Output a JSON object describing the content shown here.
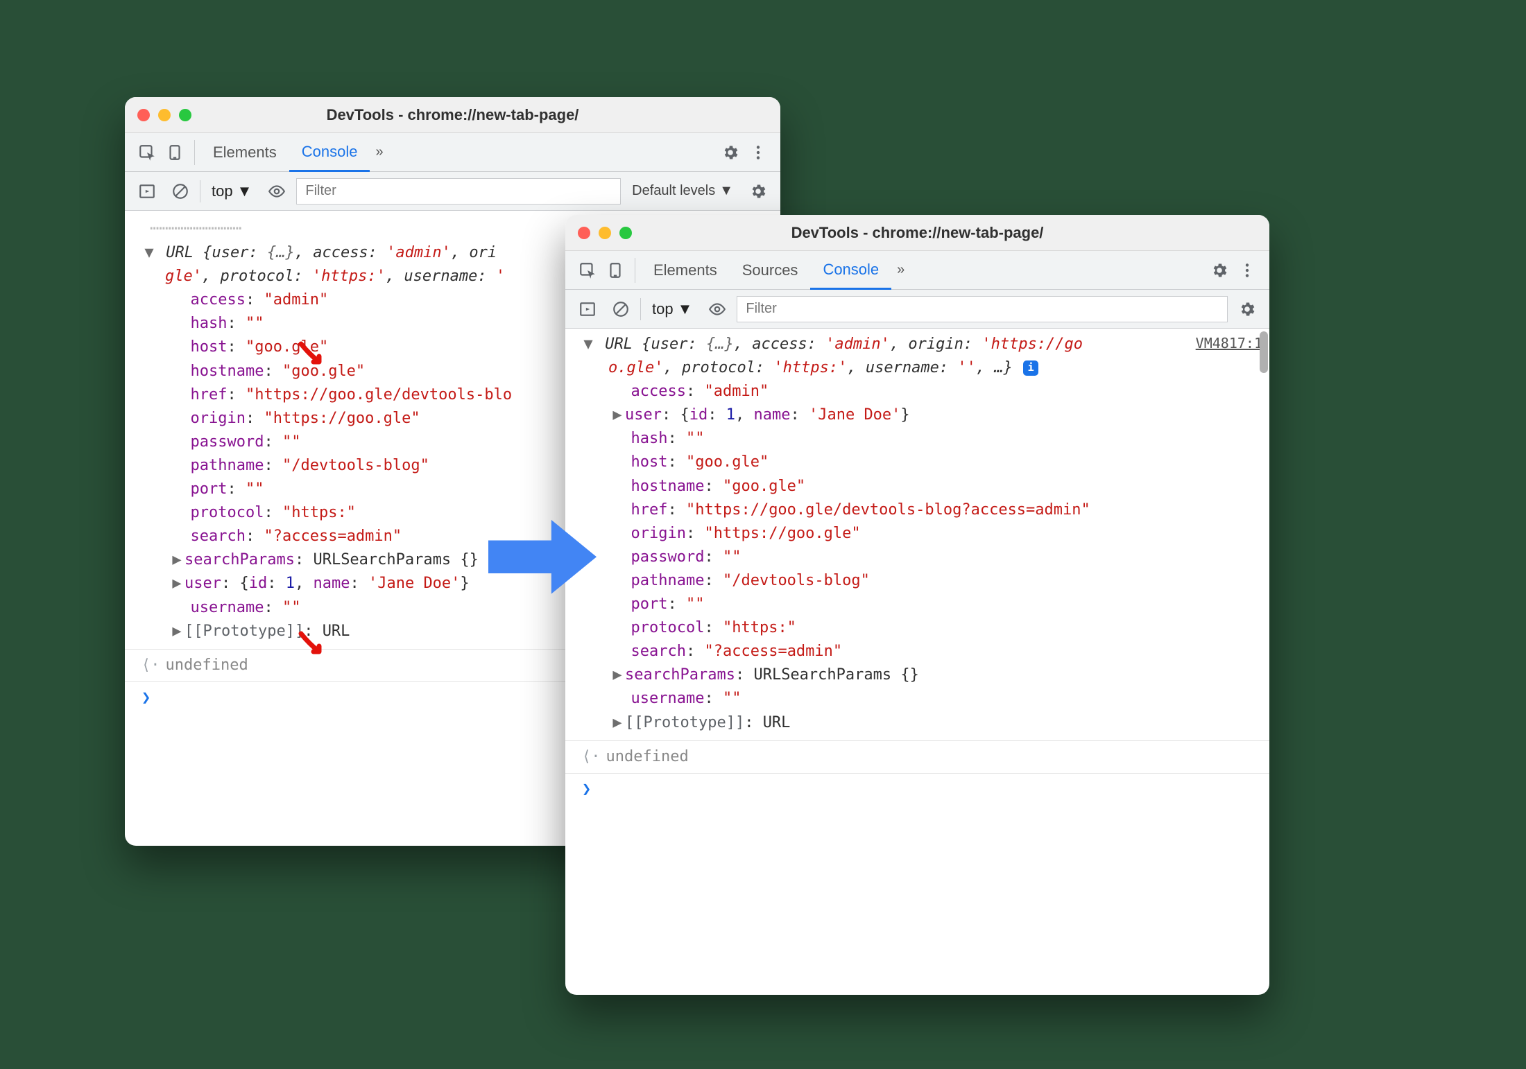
{
  "leftWindow": {
    "title": "DevTools - chrome://new-tab-page/",
    "tabs": {
      "elements": "Elements",
      "console": "Console",
      "active": "console"
    },
    "filterPlaceholder": "Filter",
    "context": "top",
    "levelsLabel": "Default levels",
    "fadedPrev": "console.log(temp);",
    "summary": {
      "class": "URL",
      "line1_parts": [
        "{user: ",
        "{…}",
        ", access: ",
        "'admin'",
        ", orig"
      ],
      "line2_parts": [
        "gle'",
        ", protocol: ",
        "'https:'",
        ", username: ",
        "'"
      ]
    },
    "props": [
      {
        "k": "access",
        "v": "\"admin\"",
        "t": "str"
      },
      {
        "k": "hash",
        "v": "\"\"",
        "t": "str"
      },
      {
        "k": "host",
        "v": "\"goo.gle\"",
        "t": "str"
      },
      {
        "k": "hostname",
        "v": "\"goo.gle\"",
        "t": "str"
      },
      {
        "k": "href",
        "v": "\"https://goo.gle/devtools-blo",
        "t": "str"
      },
      {
        "k": "origin",
        "v": "\"https://goo.gle\"",
        "t": "str"
      },
      {
        "k": "password",
        "v": "\"\"",
        "t": "str"
      },
      {
        "k": "pathname",
        "v": "\"/devtools-blog\"",
        "t": "str"
      },
      {
        "k": "port",
        "v": "\"\"",
        "t": "str"
      },
      {
        "k": "protocol",
        "v": "\"https:\"",
        "t": "str"
      },
      {
        "k": "search",
        "v": "\"?access=admin\"",
        "t": "str"
      }
    ],
    "searchParamsLine": {
      "k": "searchParams",
      "cls": "URLSearchParams",
      "suffix": "{}"
    },
    "userLine": {
      "k": "user",
      "inner": [
        [
          "id",
          ": "
        ],
        [
          "1",
          ""
        ],
        [
          ", ",
          ""
        ],
        [
          "name",
          ": "
        ],
        [
          "'Jane Doe'",
          ""
        ]
      ],
      "wrap": [
        "{",
        "}"
      ]
    },
    "usernameLine": {
      "k": "username",
      "v": "\"\""
    },
    "protoLine": {
      "k": "[[Prototype]]",
      "v": "URL"
    },
    "returnValue": "undefined"
  },
  "rightWindow": {
    "title": "DevTools - chrome://new-tab-page/",
    "tabs": {
      "elements": "Elements",
      "sources": "Sources",
      "console": "Console",
      "active": "console"
    },
    "filterPlaceholder": "Filter",
    "context": "top",
    "sourceLink": "VM4817:1",
    "summary": {
      "class": "URL",
      "line1": [
        "{user: ",
        "{…}",
        ", access: ",
        "'admin'",
        ", origin: ",
        "'https://go"
      ],
      "line2": [
        "o.gle'",
        ", protocol: ",
        "'https:'",
        ", username: ",
        "''",
        ", …}"
      ]
    },
    "topProps": [
      {
        "k": "access",
        "v": "\"admin\"",
        "t": "str"
      }
    ],
    "userExpand": {
      "k": "user",
      "inner_id_k": "id",
      "inner_id_v": "1",
      "inner_name_k": "name",
      "inner_name_v": "'Jane Doe'"
    },
    "props": [
      {
        "k": "hash",
        "v": "\"\"",
        "t": "str"
      },
      {
        "k": "host",
        "v": "\"goo.gle\"",
        "t": "str"
      },
      {
        "k": "hostname",
        "v": "\"goo.gle\"",
        "t": "str"
      },
      {
        "k": "href",
        "v": "\"https://goo.gle/devtools-blog?access=admin\"",
        "t": "str"
      },
      {
        "k": "origin",
        "v": "\"https://goo.gle\"",
        "t": "str"
      },
      {
        "k": "password",
        "v": "\"\"",
        "t": "str"
      },
      {
        "k": "pathname",
        "v": "\"/devtools-blog\"",
        "t": "str"
      },
      {
        "k": "port",
        "v": "\"\"",
        "t": "str"
      },
      {
        "k": "protocol",
        "v": "\"https:\"",
        "t": "str"
      },
      {
        "k": "search",
        "v": "\"?access=admin\"",
        "t": "str"
      }
    ],
    "searchParamsLine": {
      "k": "searchParams",
      "cls": "URLSearchParams",
      "suffix": "{}"
    },
    "usernameLine": {
      "k": "username",
      "v": "\"\""
    },
    "protoLine": {
      "k": "[[Prototype]]",
      "v": "URL"
    },
    "returnValue": "undefined"
  }
}
